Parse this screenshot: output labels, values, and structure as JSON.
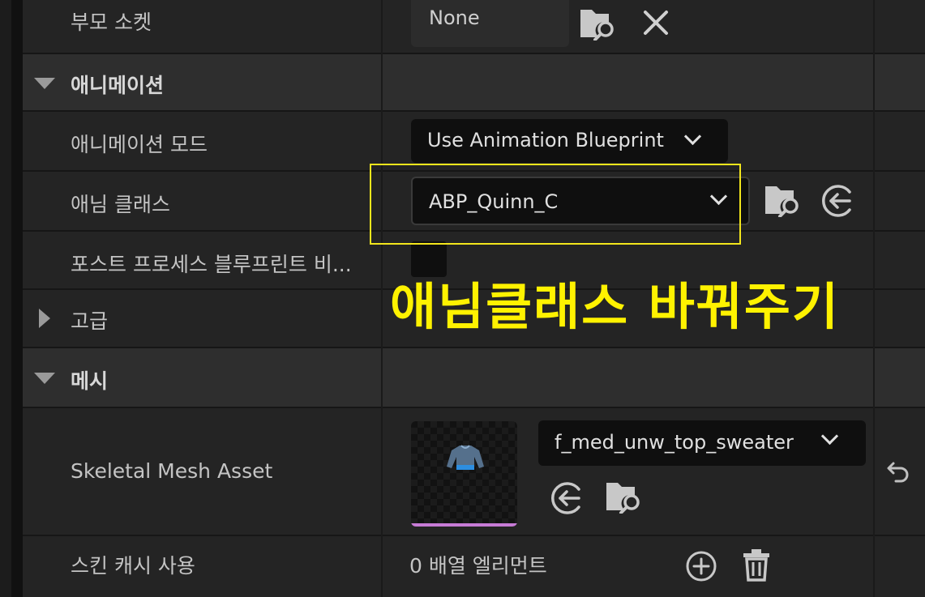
{
  "rows": {
    "parent_socket": {
      "label": "부모 소켓",
      "value": "None"
    },
    "animation_category": {
      "label": "애니메이션"
    },
    "animation_mode": {
      "label": "애니메이션 모드",
      "value": "Use Animation Blueprint"
    },
    "anim_class": {
      "label": "애님 클래스",
      "value": "ABP_Quinn_C"
    },
    "post_process": {
      "label": "포스트 프로세스 블루프린트 비..."
    },
    "advanced": {
      "label": "고급"
    },
    "mesh_category": {
      "label": "메시"
    },
    "skeletal_mesh": {
      "label": "Skeletal Mesh Asset",
      "value": "f_med_unw_top_sweater"
    },
    "skin_cache": {
      "label": "스킨 캐시 사용",
      "value": "0 배열 엘리먼트"
    }
  },
  "annotation": {
    "text": "애님클래스 바꿔주기"
  },
  "icons": {
    "browse": "folder-search-icon",
    "clear": "close-icon",
    "use_selected": "arrow-left-circle-icon",
    "reset": "reset-arrow-icon",
    "add": "plus-circle-icon",
    "delete": "trash-icon"
  },
  "colors": {
    "annotation": "#fff200",
    "highlight_box": "#f3e61c",
    "thumbnail_bar": "#c77bd6"
  }
}
